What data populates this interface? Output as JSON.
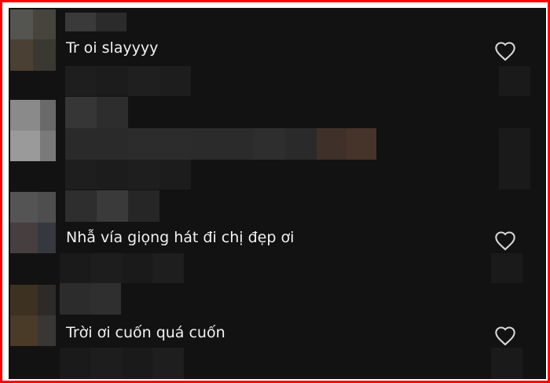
{
  "comments": [
    {
      "text": "Tr oi slayyyy",
      "icon": "heart-icon"
    },
    {
      "text": "",
      "icon": ""
    },
    {
      "text": "Nhẫ vía giọng hát đi chị đẹp ơi",
      "icon": "heart-icon"
    },
    {
      "text": "Trời ơi cuốn quá cuốn",
      "icon": "heart-icon"
    }
  ],
  "colors": {
    "background": "#121212",
    "text": "#f1f1f1",
    "border": "#ff0000"
  }
}
